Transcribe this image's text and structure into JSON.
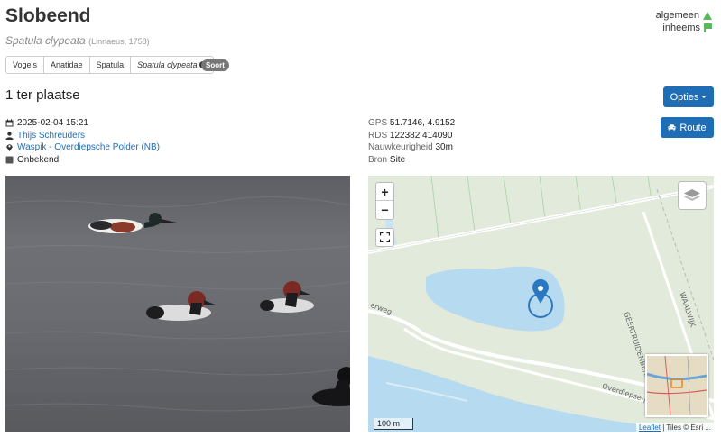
{
  "species": {
    "common_name": "Slobeend",
    "scientific_name": "Spatula clypeata",
    "author": "(Linnaeus, 1758)"
  },
  "status": {
    "rarity": "algemeen",
    "origin": "inheems"
  },
  "taxonomy": {
    "crumbs": [
      "Vogels",
      "Anatidae",
      "Spatula",
      "Spatula clypeata"
    ],
    "badge": "Soort"
  },
  "heading": "1 ter plaatse",
  "buttons": {
    "options": "Opties",
    "route": "Route"
  },
  "observation": {
    "datetime": "2025-02-04 15:21",
    "observer": "Thijs Schreuders",
    "location": "Waspik - Overdiepsche Polder (NB)",
    "activity": "Onbekend"
  },
  "geo": {
    "gps_label": "GPS",
    "gps_value": "51.7146, 4.9152",
    "rds_label": "RDS",
    "rds_value": "122382 414090",
    "accuracy_label": "Nauwkeurigheid",
    "accuracy_value": "30m",
    "source_label": "Bron",
    "source_value": "Site"
  },
  "map": {
    "zoom_in": "+",
    "zoom_out": "−",
    "scale": "100 m",
    "attribution_link": "Leaflet",
    "attribution_text": "| Tiles © Esri ...",
    "street_1": "erweg",
    "street_2": "Overdiepse-p...",
    "street_3": "GEERTRUIDENBER...",
    "street_4": "WAALWIJK"
  },
  "colors": {
    "primary": "#1f6db5",
    "status_green": "#5cb85c",
    "badge_gray": "#777777",
    "water": "#b6daf0",
    "pin": "#2a78c2"
  }
}
